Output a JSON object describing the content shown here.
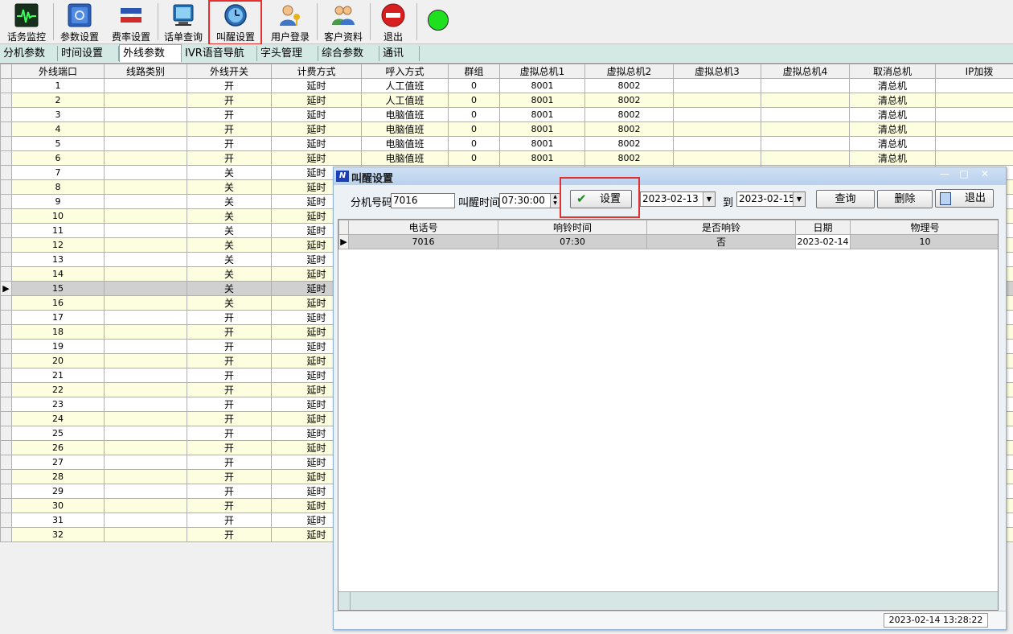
{
  "toolbar": {
    "monitor": "话务监控",
    "params": "参数设置",
    "rate": "费率设置",
    "query": "话单查询",
    "wakeup": "叫醒设置",
    "login": "用户登录",
    "customer": "客户资料",
    "exit": "退出"
  },
  "status_color": "#1fe01f",
  "highlight_color": "#e53030",
  "tabs": [
    "分机参数",
    "时间设置",
    "外线参数",
    "IVR语音导航",
    "字头管理",
    "综合参数",
    "通讯"
  ],
  "active_tab": "外线参数",
  "main_table": {
    "columns": [
      "外线端口",
      "线路类别",
      "外线开关",
      "计费方式",
      "呼入方式",
      "群组",
      "虚拟总机1",
      "虚拟总机2",
      "虚拟总机3",
      "虚拟总机4",
      "取消总机",
      "IP加拨"
    ],
    "selected_row": 15,
    "rows": [
      [
        "1",
        "",
        "开",
        "延时",
        "人工值班",
        "0",
        "8001",
        "8002",
        "",
        "",
        "清总机",
        ""
      ],
      [
        "2",
        "",
        "开",
        "延时",
        "人工值班",
        "0",
        "8001",
        "8002",
        "",
        "",
        "清总机",
        ""
      ],
      [
        "3",
        "",
        "开",
        "延时",
        "电脑值班",
        "0",
        "8001",
        "8002",
        "",
        "",
        "清总机",
        ""
      ],
      [
        "4",
        "",
        "开",
        "延时",
        "电脑值班",
        "0",
        "8001",
        "8002",
        "",
        "",
        "清总机",
        ""
      ],
      [
        "5",
        "",
        "开",
        "延时",
        "电脑值班",
        "0",
        "8001",
        "8002",
        "",
        "",
        "清总机",
        ""
      ],
      [
        "6",
        "",
        "开",
        "延时",
        "电脑值班",
        "0",
        "8001",
        "8002",
        "",
        "",
        "清总机",
        ""
      ],
      [
        "7",
        "",
        "关",
        "延时",
        "",
        "",
        "",
        "",
        "",
        "",
        "",
        ""
      ],
      [
        "8",
        "",
        "关",
        "延时",
        "",
        "",
        "",
        "",
        "",
        "",
        "",
        ""
      ],
      [
        "9",
        "",
        "关",
        "延时",
        "",
        "",
        "",
        "",
        "",
        "",
        "",
        ""
      ],
      [
        "10",
        "",
        "关",
        "延时",
        "",
        "",
        "",
        "",
        "",
        "",
        "",
        ""
      ],
      [
        "11",
        "",
        "关",
        "延时",
        "",
        "",
        "",
        "",
        "",
        "",
        "",
        ""
      ],
      [
        "12",
        "",
        "关",
        "延时",
        "",
        "",
        "",
        "",
        "",
        "",
        "",
        ""
      ],
      [
        "13",
        "",
        "关",
        "延时",
        "",
        "",
        "",
        "",
        "",
        "",
        "",
        ""
      ],
      [
        "14",
        "",
        "关",
        "延时",
        "",
        "",
        "",
        "",
        "",
        "",
        "",
        ""
      ],
      [
        "15",
        "",
        "关",
        "延时",
        "",
        "",
        "",
        "",
        "",
        "",
        "",
        ""
      ],
      [
        "16",
        "",
        "关",
        "延时",
        "",
        "",
        "",
        "",
        "",
        "",
        "",
        ""
      ],
      [
        "17",
        "",
        "开",
        "延时",
        "",
        "",
        "",
        "",
        "",
        "",
        "",
        ""
      ],
      [
        "18",
        "",
        "开",
        "延时",
        "",
        "",
        "",
        "",
        "",
        "",
        "",
        ""
      ],
      [
        "19",
        "",
        "开",
        "延时",
        "",
        "",
        "",
        "",
        "",
        "",
        "",
        ""
      ],
      [
        "20",
        "",
        "开",
        "延时",
        "",
        "",
        "",
        "",
        "",
        "",
        "",
        ""
      ],
      [
        "21",
        "",
        "开",
        "延时",
        "",
        "",
        "",
        "",
        "",
        "",
        "",
        ""
      ],
      [
        "22",
        "",
        "开",
        "延时",
        "",
        "",
        "",
        "",
        "",
        "",
        "",
        ""
      ],
      [
        "23",
        "",
        "开",
        "延时",
        "",
        "",
        "",
        "",
        "",
        "",
        "",
        ""
      ],
      [
        "24",
        "",
        "开",
        "延时",
        "",
        "",
        "",
        "",
        "",
        "",
        "",
        ""
      ],
      [
        "25",
        "",
        "开",
        "延时",
        "",
        "",
        "",
        "",
        "",
        "",
        "",
        ""
      ],
      [
        "26",
        "",
        "开",
        "延时",
        "",
        "",
        "",
        "",
        "",
        "",
        "",
        ""
      ],
      [
        "27",
        "",
        "开",
        "延时",
        "",
        "",
        "",
        "",
        "",
        "",
        "",
        ""
      ],
      [
        "28",
        "",
        "开",
        "延时",
        "",
        "",
        "",
        "",
        "",
        "",
        "",
        ""
      ],
      [
        "29",
        "",
        "开",
        "延时",
        "",
        "",
        "",
        "",
        "",
        "",
        "",
        ""
      ],
      [
        "30",
        "",
        "开",
        "延时",
        "",
        "",
        "",
        "",
        "",
        "",
        "",
        ""
      ],
      [
        "31",
        "",
        "开",
        "延时",
        "",
        "",
        "",
        "",
        "",
        "",
        "",
        ""
      ],
      [
        "32",
        "",
        "开",
        "延时",
        "",
        "",
        "",
        "",
        "",
        "",
        "",
        ""
      ]
    ]
  },
  "dialog": {
    "title": "叫醒设置",
    "ext_label": "分机号码",
    "ext_value": "7016",
    "time_label": "叫醒时间",
    "time_value": "07:30:00",
    "set_button": "设置",
    "date_from": "2023-02-13",
    "to_label": "到",
    "date_to": "2023-02-15",
    "query_button": "查询",
    "delete_button": "删除",
    "exit_button": "退出",
    "columns": [
      "电话号",
      "响铃时间",
      "是否响铃",
      "日期",
      "物理号"
    ],
    "rows": [
      [
        "7016",
        "07:30",
        "否",
        "2023-02-14",
        "10"
      ]
    ],
    "status_time": "2023-02-14  13:28:22"
  }
}
